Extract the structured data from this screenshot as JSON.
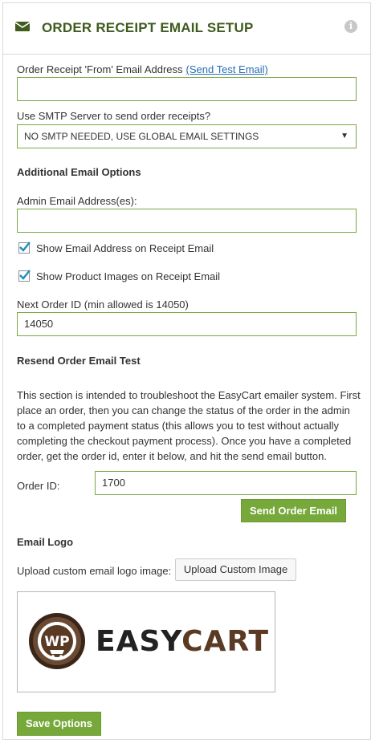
{
  "header": {
    "title": "ORDER RECEIPT EMAIL SETUP",
    "icon": "envelope-icon",
    "info_icon": "info-icon"
  },
  "from_email": {
    "label": "Order Receipt 'From' Email Address",
    "link_label": "(Send Test Email)",
    "value": ""
  },
  "smtp": {
    "label": "Use SMTP Server to send order receipts?",
    "selected": "NO SMTP NEEDED, USE GLOBAL EMAIL SETTINGS"
  },
  "additional": {
    "heading": "Additional Email Options",
    "admin_label": "Admin Email Address(es):",
    "admin_value": "",
    "show_email_label": "Show Email Address on Receipt Email",
    "show_email_checked": true,
    "show_images_label": "Show Product Images on Receipt Email",
    "show_images_checked": true,
    "next_order_label": "Next Order ID (min allowed is 14050)",
    "next_order_value": "14050"
  },
  "resend": {
    "heading": "Resend Order Email Test",
    "description": "This section is intended to troubleshoot the EasyCart emailer system. First place an order, then you can change the status of the order in the admin to a completed payment status (this allows you to test without actually completing the checkout payment process). Once you have a completed order, get the order id, enter it below, and hit the send email button.",
    "order_id_label": "Order ID:",
    "order_id_value": "1700",
    "send_button": "Send Order Email"
  },
  "logo": {
    "heading": "Email Logo",
    "upload_label": "Upload custom email logo image:",
    "upload_button": "Upload Custom Image",
    "badge_text": "WP",
    "brand_part1": "EASY",
    "brand_part2": "CART"
  },
  "save_button": "Save Options",
  "colors": {
    "accent_green": "#76a83a",
    "title_green": "#3f5b1e",
    "input_border": "#7aa845",
    "link_blue": "#2a6eb5",
    "brand_dark": "#222222",
    "brand_brown": "#5b3a24"
  }
}
